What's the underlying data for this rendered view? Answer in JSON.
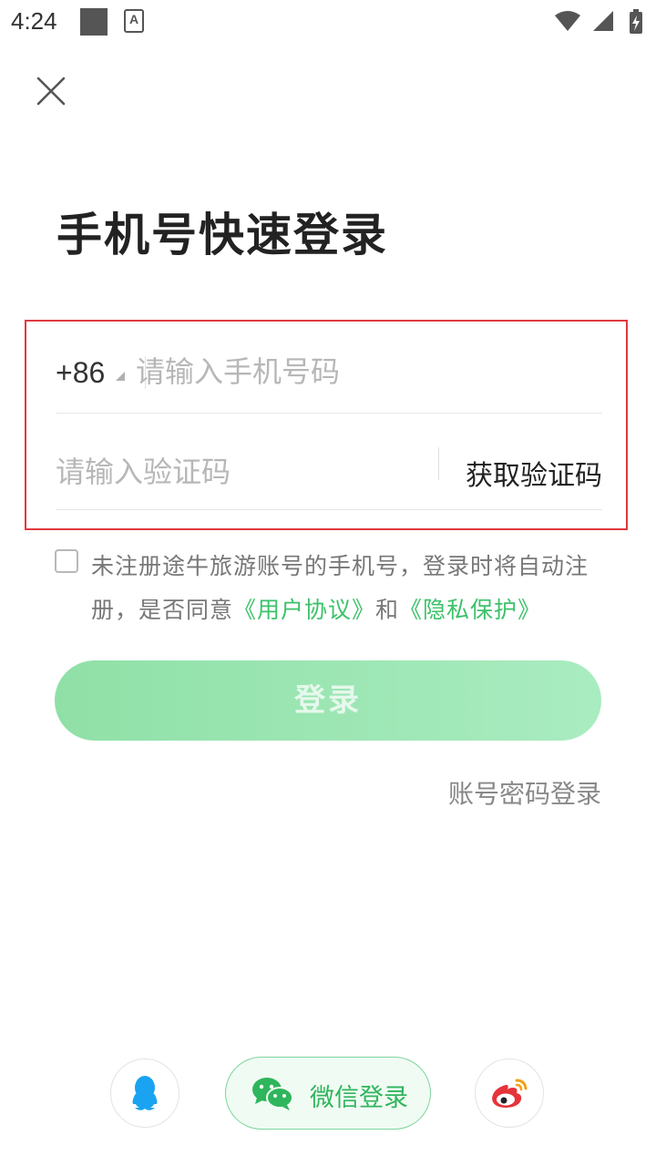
{
  "status_bar": {
    "time": "4:24",
    "icons": [
      "notification-square-icon",
      "a-text-icon",
      "wifi-icon",
      "signal-icon",
      "battery-charging-icon"
    ]
  },
  "header": {
    "close_icon": "close-icon",
    "title": "手机号快速登录"
  },
  "form": {
    "country_code": "+86",
    "phone_placeholder": "请输入手机号码",
    "code_placeholder": "请输入验证码",
    "get_code_label": "获取验证码"
  },
  "agreement": {
    "checked": false,
    "text_prefix": "未注册途牛旅游账号的手机号，登录时将自动注册，是否同意",
    "user_agreement": "《用户协议》",
    "and": "和",
    "privacy": "《隐私保护》"
  },
  "actions": {
    "login_label": "登录",
    "password_login_label": "账号密码登录"
  },
  "social": {
    "wechat_label": "微信登录",
    "icons": [
      "qq-icon",
      "wechat-icon",
      "weibo-icon"
    ]
  },
  "colors": {
    "accent_green": "#3cc26a",
    "login_button": "#8fe0a7",
    "highlight_border": "#e0393e"
  }
}
